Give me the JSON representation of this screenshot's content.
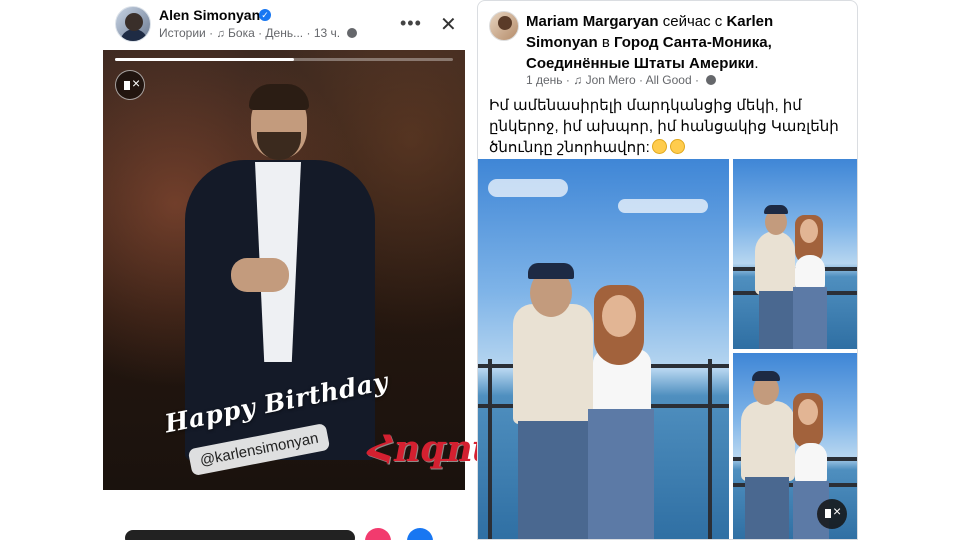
{
  "story": {
    "author": "Alen Simonyan",
    "section": "Истории",
    "music": "Бока · День...",
    "time": "13 ч.",
    "birthday_text": "Happy Birthday",
    "mention": "@karlensimonyan",
    "progress_fraction": 0.53
  },
  "watermark": "Հոգովուրդ",
  "post": {
    "author": "Mariam Margaryan",
    "with_text": " сейчас с ",
    "tagged": "Karlen Simonyan",
    "in_text": " в ",
    "location": "Город Санта-Моника, Соединённые Штаты Америки",
    "period": ".",
    "time": "1 день",
    "music": "Jon Mero · All Good",
    "body": "Իմ ամենասիրելի մարդկանցից մեկի, իմ ընկերոջ, իմ ախպոր, իմ հանցակից Կառլենի ծնունդը շնորհավոր:"
  },
  "colors": {
    "verified": "#1877f2",
    "watermark": "#d42030",
    "meta_text": "#65676b"
  }
}
